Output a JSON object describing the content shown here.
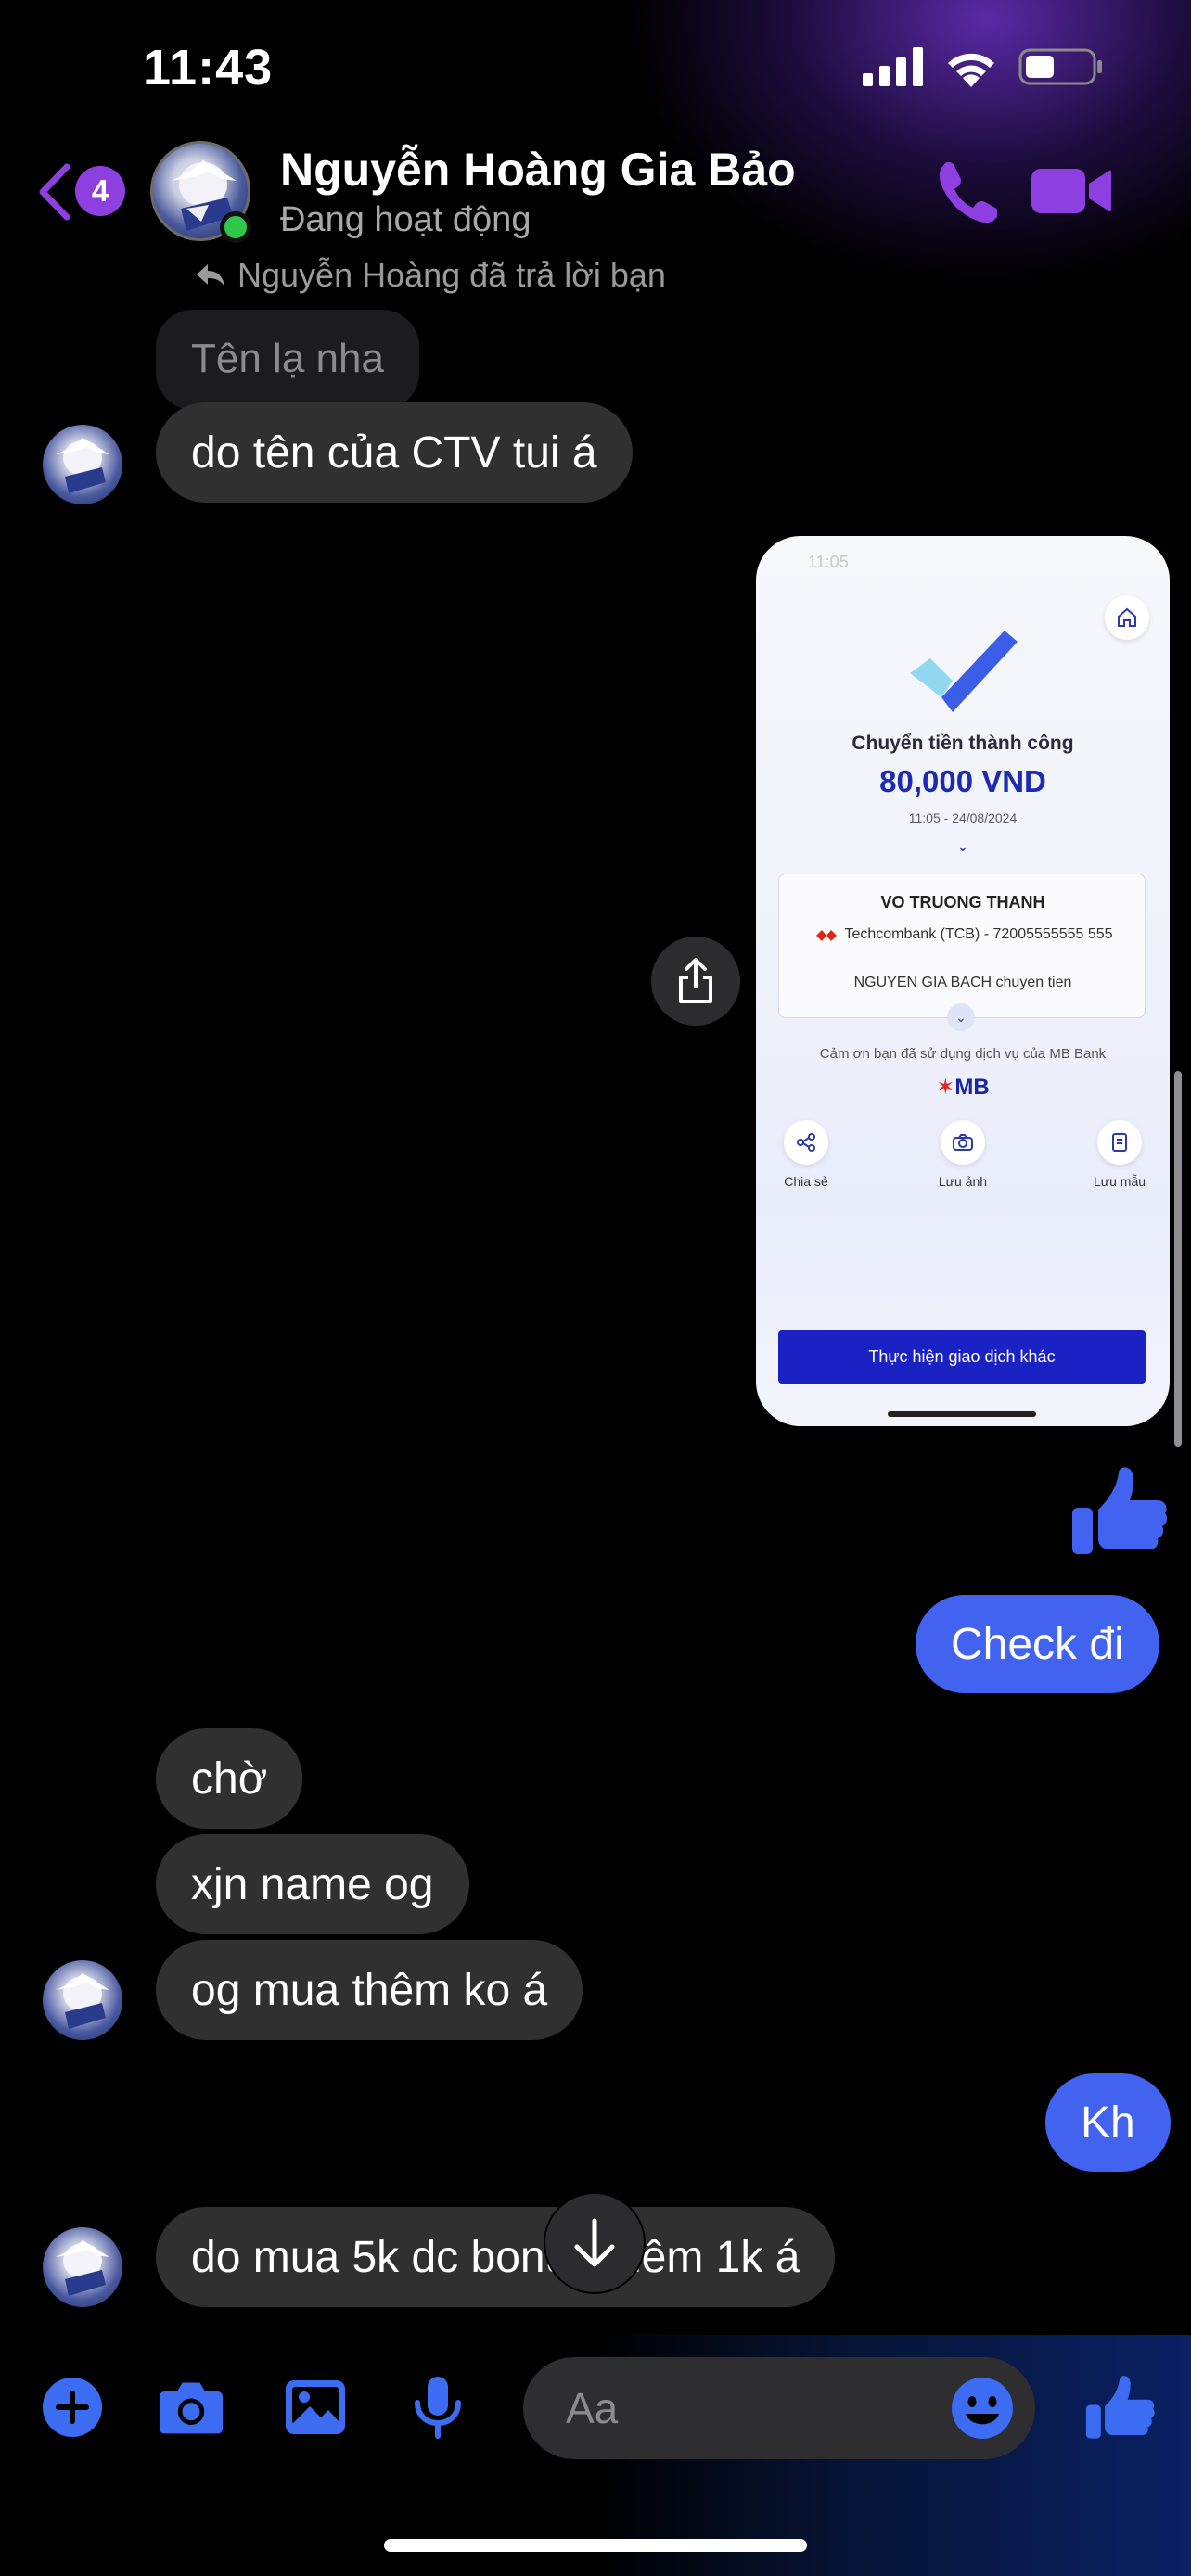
{
  "status_bar": {
    "time": "11:43"
  },
  "header": {
    "back_badge": "4",
    "contact_name": "Nguyễn Hoàng Gia Bảo",
    "contact_status": "Đang hoạt động",
    "call_icon": "phone-icon",
    "video_icon": "video-camera-icon"
  },
  "messages": {
    "reply_note": "Nguyễn Hoàng đã trả lời bạn",
    "quoted": "Tên lạ nha",
    "m1": "do tên của CTV tui á",
    "m_check": "Check đi",
    "m_wait": "chờ",
    "m_name": "xjn name og",
    "m_buy": "og mua thêm ko á",
    "m_kh": "Kh",
    "m_last": "do mua 5k dc bonus thêm 1k á"
  },
  "receipt": {
    "statusbar_time": "11:05",
    "title": "Chuyển tiền thành công",
    "amount": "80,000 VND",
    "datetime": "11:05 - 24/08/2024",
    "recipient": "VO TRUONG THANH",
    "bank_line": "Techcombank (TCB) - 72005555555 555",
    "note": "NGUYEN GIA BACH chuyen tien",
    "thanks": "Cảm ơn bạn đã sử dụng dịch vụ của MB Bank",
    "brand": "MB",
    "actions": [
      "Chia sẻ",
      "Lưu ảnh",
      "Lưu mẫu"
    ],
    "cta": "Thực hiện giao dịch khác"
  },
  "composer": {
    "placeholder": "Aa",
    "icons": [
      "plus-icon",
      "camera-icon",
      "gallery-icon",
      "microphone-icon",
      "emoji-icon",
      "thumbs-up-icon"
    ]
  },
  "colors": {
    "accent_purple": "#8e3fe0",
    "outgoing_bubble": "#4163f0",
    "incoming_bubble": "#303030",
    "online": "#2fc84b"
  }
}
